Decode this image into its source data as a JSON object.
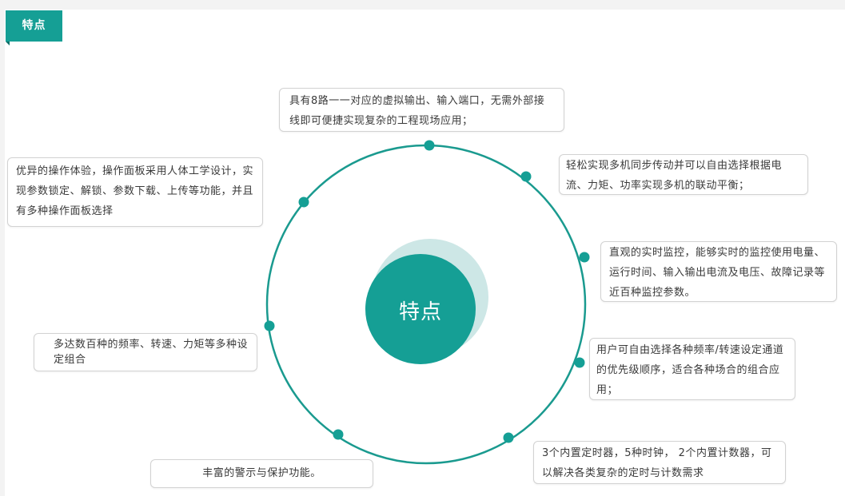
{
  "tag": {
    "label": "特点"
  },
  "center": {
    "label": "特点"
  },
  "colors": {
    "accent": "#159f95",
    "halo": "#cde7e6",
    "ring": "#1a9a8f"
  },
  "features": {
    "top": "具有8路一一对应的虚拟输出、输入端口，无需外部接线即可便捷实现复杂的工程现场应用；",
    "top_right": "轻松实现多机同步传动并可以自由选择根据电流、力矩、功率实现多机的联动平衡；",
    "right": "直观的实时监控，能够实时的监控使用电量、运行时间、输入输出电流及电压、故障记录等近百种监控参数。",
    "right_lower": "用户可自由选择各种频率/转速设定通道的优先级顺序，适合各种场合的组合应用；",
    "bottom_right": "3个内置定时器，5种时钟， 2个内置计数器，可以解决各类复杂的定时与计数需求",
    "bottom": "丰富的警示与保护功能。",
    "left": "多达数百种的频率、转速、力矩等多种设定组合",
    "top_left": "优异的操作体验，操作面板采用人体工学设计，实现参数锁定、解锁、参数下载、上传等功能，并且有多种操作面板选择"
  }
}
